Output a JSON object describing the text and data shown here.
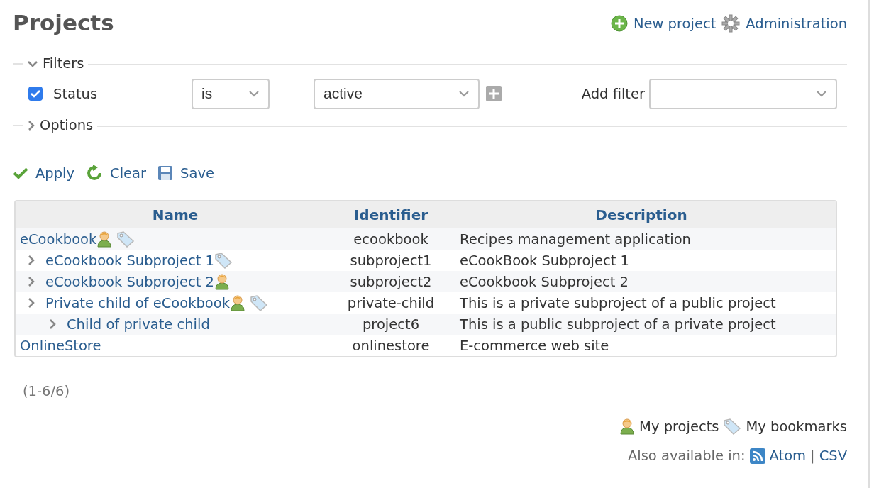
{
  "title": "Projects",
  "header_links": [
    {
      "kind": "new",
      "label": "New project"
    },
    {
      "kind": "admin",
      "label": "Administration"
    }
  ],
  "filters": {
    "legend": "Filters",
    "expanded": true,
    "rows": [
      {
        "label": "Status",
        "checked": true,
        "operator": "is",
        "value": "active"
      }
    ],
    "add_filter_label": "Add filter"
  },
  "options": {
    "legend": "Options",
    "expanded": false
  },
  "actions": [
    {
      "kind": "apply",
      "label": "Apply"
    },
    {
      "kind": "clear",
      "label": "Clear"
    },
    {
      "kind": "save",
      "label": "Save"
    }
  ],
  "table": {
    "columns": [
      "Name",
      "Identifier",
      "Description"
    ],
    "rows": [
      {
        "name": "eCookbook",
        "identifier": "ecookbook",
        "description": "Recipes management application",
        "member": true,
        "bookmarked": true,
        "children": [
          {
            "name": "eCookbook Subproject 1",
            "identifier": "subproject1",
            "description": "eCookBook Subproject 1",
            "member": false,
            "bookmarked": true
          },
          {
            "name": "eCookbook Subproject 2",
            "identifier": "subproject2",
            "description": "eCookbook Subproject 2",
            "member": true,
            "bookmarked": false
          },
          {
            "name": "Private child of eCookbook",
            "identifier": "private-child",
            "description": "This is a private subproject of a public project",
            "member": true,
            "bookmarked": true,
            "children": [
              {
                "name": "Child of private child",
                "identifier": "project6",
                "description": "This is a public subproject of a private project",
                "member": false,
                "bookmarked": false
              }
            ]
          }
        ]
      },
      {
        "name": "OnlineStore",
        "identifier": "onlinestore",
        "description": "E-commerce web site",
        "member": false,
        "bookmarked": false
      }
    ]
  },
  "pagination": "(1-6/6)",
  "legend": [
    {
      "kind": "member",
      "label": "My projects"
    },
    {
      "kind": "bookmark",
      "label": "My bookmarks"
    }
  ],
  "export": {
    "label": "Also available in:",
    "formats": [
      {
        "kind": "atom",
        "label": "Atom"
      },
      {
        "kind": "csv",
        "label": "CSV"
      }
    ],
    "separator": "|"
  }
}
